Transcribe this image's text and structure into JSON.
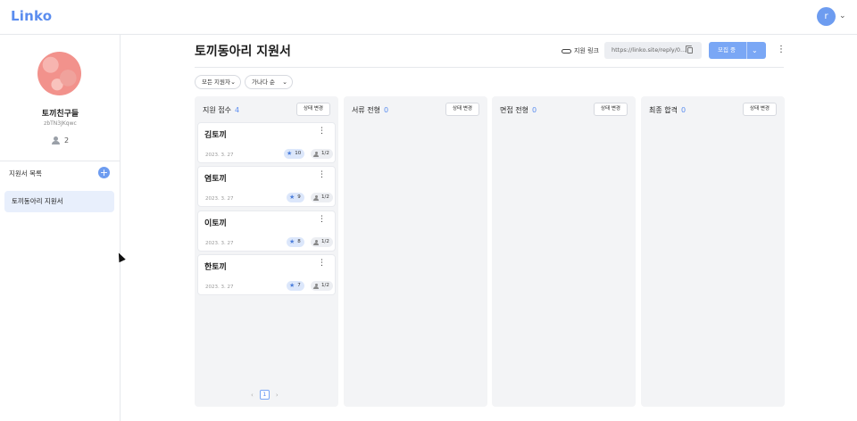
{
  "app": {
    "logo": "Linko",
    "user_initial": "r"
  },
  "sidebar": {
    "club_name": "토끼친구들",
    "club_id": "zbTN3JKqwc",
    "member_count": "2",
    "list_title": "지원서 목록",
    "add_label": "+",
    "items": [
      {
        "label": "토끼동아리 지원서"
      }
    ]
  },
  "header": {
    "title": "토끼동아리 지원서",
    "link_label": "지원 링크",
    "url": "https://linko.site/reply/0...",
    "recruit_label": "모집 중"
  },
  "filters": [
    {
      "label": "모든 지원자"
    },
    {
      "label": "가나다 순"
    }
  ],
  "columns": [
    {
      "title": "지원 접수",
      "count": "4",
      "status_btn": "상태 변경",
      "cards": [
        {
          "name": "김토끼",
          "date": "2023. 3. 27",
          "stars": "10",
          "progress": "1/2"
        },
        {
          "name": "염토끼",
          "date": "2023. 3. 27",
          "stars": "9",
          "progress": "1/2"
        },
        {
          "name": "이토끼",
          "date": "2023. 3. 27",
          "stars": "8",
          "progress": "1/2"
        },
        {
          "name": "한토끼",
          "date": "2023. 3. 27",
          "stars": "7",
          "progress": "1/2"
        }
      ]
    },
    {
      "title": "서류 전형",
      "count": "0",
      "status_btn": "상태 변경",
      "cards": []
    },
    {
      "title": "면접 전형",
      "count": "0",
      "status_btn": "상태 변경",
      "cards": []
    },
    {
      "title": "최종 합격",
      "count": "0",
      "status_btn": "상태 변경",
      "cards": []
    }
  ],
  "pagination": {
    "current": "1"
  },
  "colors": {
    "accent": "#5b8def",
    "button": "#7aa7f5",
    "column_bg": "#f3f4f6"
  }
}
